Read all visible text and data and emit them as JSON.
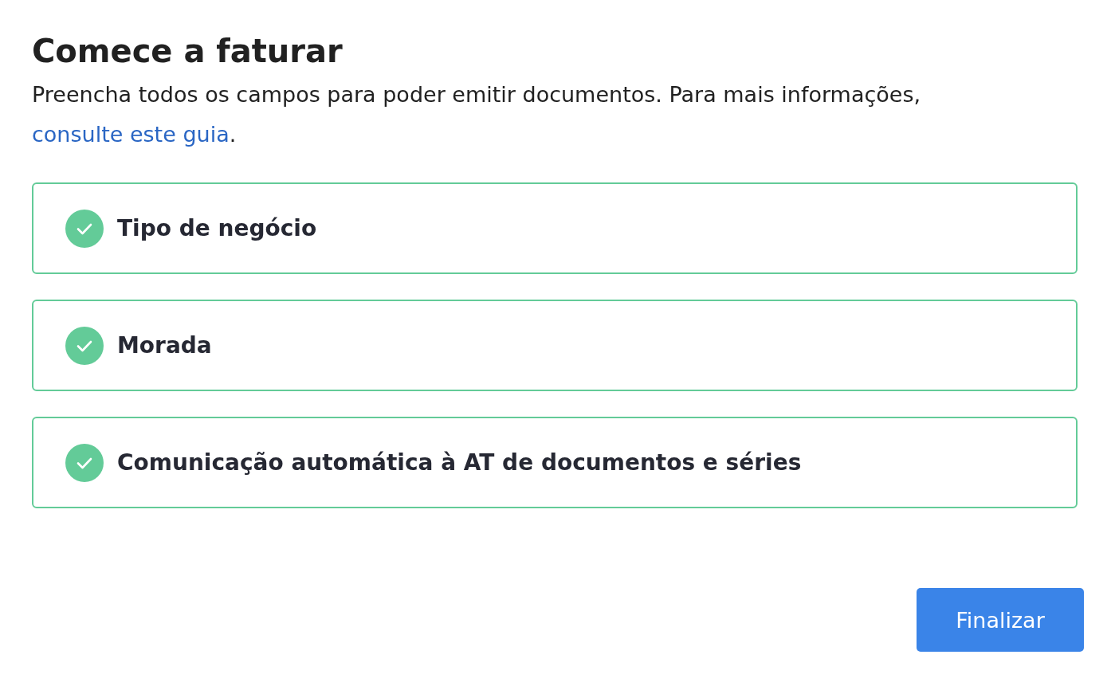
{
  "title": "Comece a faturar",
  "intro": {
    "text_before": "Preencha todos os campos para poder emitir documentos. Para mais informações, ",
    "link": "consulte este guia",
    "text_after": "."
  },
  "steps": [
    {
      "label": "Tipo de negócio",
      "completed": true
    },
    {
      "label": "Morada",
      "completed": true
    },
    {
      "label": "Comunicação automática à AT de documentos e séries",
      "completed": true
    }
  ],
  "finish_button": "Finalizar"
}
